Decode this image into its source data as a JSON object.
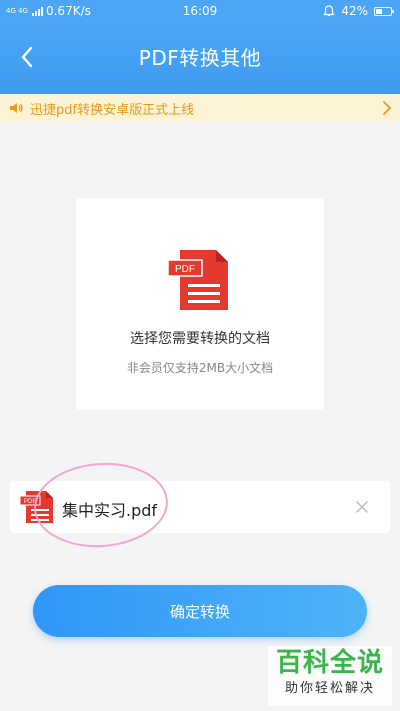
{
  "status_bar": {
    "network_badge": "4G 4G",
    "speed": "0.67K/s",
    "time": "16:09",
    "battery_level": "42%",
    "battery_fraction": 0.42,
    "icons": [
      "signal-icon",
      "alarm-icon",
      "battery-icon"
    ]
  },
  "header": {
    "title": "PDF转换其他",
    "back_icon": "chevron-left-icon",
    "background": "#4aa5f4"
  },
  "notice": {
    "text": "迅捷pdf转换安卓版正式上线",
    "icon": "speaker-icon",
    "color": "#ea9a1e"
  },
  "select_card": {
    "icon_label": "PDF",
    "title": "选择您需要转换的文档",
    "subtitle": "非会员仅支持2MB大小文档"
  },
  "file": {
    "icon_label": "PDF",
    "name": "集中实习.pdf",
    "remove_icon": "close-icon"
  },
  "confirm_button": {
    "label": "确定转换",
    "color": "#2f97f7"
  },
  "watermark": {
    "title": "百科全说",
    "subtitle": "助你轻松解决"
  }
}
